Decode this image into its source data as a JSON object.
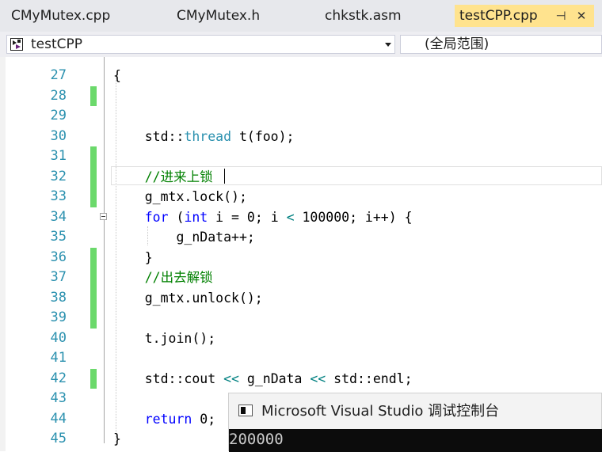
{
  "tabs": [
    {
      "label": "CMyMutex.cpp"
    },
    {
      "label": "CMyMutex.h"
    },
    {
      "label": "chkstk.asm"
    },
    {
      "label": "testCPP.cpp",
      "active": true
    }
  ],
  "tab_buttons": {
    "pin": "⊣",
    "close": "✕"
  },
  "navbar": {
    "project": "testCPP",
    "scope": "(全局范围)"
  },
  "code_lines": [
    {
      "n": "27",
      "changed": false,
      "tokens": [
        {
          "t": "{",
          "c": ""
        }
      ]
    },
    {
      "n": "28",
      "changed": true,
      "tokens": []
    },
    {
      "n": "29",
      "changed": false,
      "tokens": []
    },
    {
      "n": "30",
      "changed": false,
      "tokens": [
        {
          "t": "    std::",
          "c": ""
        },
        {
          "t": "thread",
          "c": "ty"
        },
        {
          "t": " t(foo);",
          "c": ""
        }
      ]
    },
    {
      "n": "31",
      "changed": true,
      "tokens": []
    },
    {
      "n": "32",
      "changed": true,
      "tokens": [
        {
          "t": "    //进来上锁",
          "c": "cm"
        }
      ]
    },
    {
      "n": "33",
      "changed": true,
      "tokens": [
        {
          "t": "    g_mtx.lock();",
          "c": ""
        }
      ]
    },
    {
      "n": "34",
      "changed": false,
      "tokens": [
        {
          "t": "    ",
          "c": ""
        },
        {
          "t": "for",
          "c": "kw"
        },
        {
          "t": " (",
          "c": ""
        },
        {
          "t": "int",
          "c": "kw"
        },
        {
          "t": " i = 0; i ",
          "c": ""
        },
        {
          "t": "<",
          "c": "op"
        },
        {
          "t": " 100000; i++) {",
          "c": ""
        }
      ]
    },
    {
      "n": "35",
      "changed": false,
      "tokens": [
        {
          "t": "        g_nData++;",
          "c": ""
        }
      ]
    },
    {
      "n": "36",
      "changed": true,
      "tokens": [
        {
          "t": "    }",
          "c": ""
        }
      ]
    },
    {
      "n": "37",
      "changed": true,
      "tokens": [
        {
          "t": "    //出去解锁",
          "c": "cm"
        }
      ]
    },
    {
      "n": "38",
      "changed": true,
      "tokens": [
        {
          "t": "    g_mtx.unlock();",
          "c": ""
        }
      ]
    },
    {
      "n": "39",
      "changed": true,
      "tokens": []
    },
    {
      "n": "40",
      "changed": false,
      "tokens": [
        {
          "t": "    t.join();",
          "c": ""
        }
      ]
    },
    {
      "n": "41",
      "changed": false,
      "tokens": []
    },
    {
      "n": "42",
      "changed": true,
      "tokens": [
        {
          "t": "    std::cout ",
          "c": ""
        },
        {
          "t": "<<",
          "c": "op"
        },
        {
          "t": " g_nData ",
          "c": ""
        },
        {
          "t": "<<",
          "c": "op"
        },
        {
          "t": " std::endl;",
          "c": ""
        }
      ]
    },
    {
      "n": "43",
      "changed": false,
      "tokens": []
    },
    {
      "n": "44",
      "changed": false,
      "tokens": [
        {
          "t": "    ",
          "c": ""
        },
        {
          "t": "return",
          "c": "kw"
        },
        {
          "t": " 0;",
          "c": ""
        }
      ]
    },
    {
      "n": "45",
      "changed": false,
      "tokens": [
        {
          "t": "}",
          "c": ""
        }
      ]
    }
  ],
  "console": {
    "title": "Microsoft Visual Studio 调试控制台",
    "output": "200000"
  },
  "colors": {
    "keyword": "#0000ff",
    "type": "#2b91af",
    "comment": "#008000",
    "line_number": "#2b91af",
    "change_marker": "#6bd96b",
    "active_tab": "#ffe38e"
  }
}
